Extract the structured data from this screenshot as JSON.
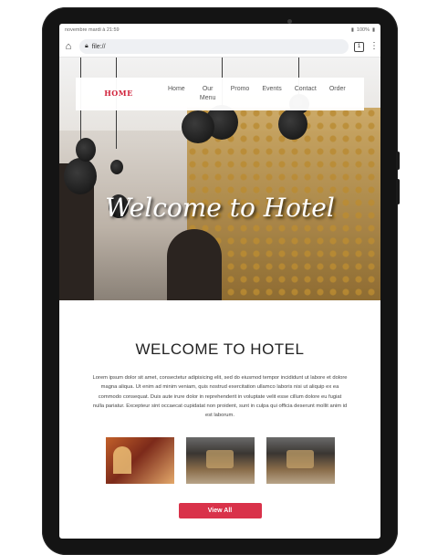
{
  "status_bar": {
    "datetime": "novembre mardi à 21:59",
    "battery": "100%"
  },
  "browser": {
    "url": "file://",
    "tab_count": "1",
    "icons": [
      "home-icon",
      "lock-icon",
      "tabs-icon",
      "more-icon"
    ]
  },
  "nav": {
    "logo": "HOME",
    "items": [
      "Home",
      "Our Menu",
      "Promo",
      "Events",
      "Contact",
      "Order"
    ]
  },
  "hero": {
    "title": "Welcome to Hotel"
  },
  "welcome": {
    "heading": "WELCOME TO HOTEL",
    "paragraph": "Lorem ipsum dolor sit amet, consectetur adipisicing elit, sed do eiusmod tempor incididunt ut labore et dolore magna aliqua. Ut enim ad minim veniam, quis nostrud exercitation ullamco laboris nisi ut aliquip ex ea commodo consequat. Duis aute irure dolor in reprehenderit in voluptate velit esse cillum dolore eu fugiat nulla pariatur. Excepteur sint occaecat cupidatat non proident, sunt in culpa qui officia deserunt mollit anim id est laborum."
  },
  "gallery": {
    "button_label": "View All"
  },
  "colors": {
    "accent": "#d9324a",
    "logo": "#d1223a"
  }
}
